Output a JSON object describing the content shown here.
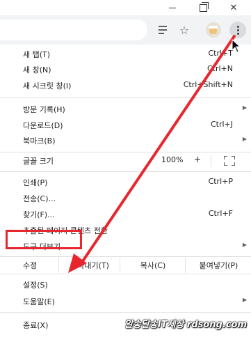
{
  "menu": {
    "new_tab": {
      "label": "새 탭(T)",
      "shortcut": "Ctrl+T"
    },
    "new_window": {
      "label": "새 창(N)",
      "shortcut": "Ctrl+N"
    },
    "incognito": {
      "label": "새 시크릿 창(I)",
      "shortcut": "Ctrl+Shift+N"
    },
    "history": {
      "label": "방문 기록(H)"
    },
    "downloads": {
      "label": "다운로드(D)",
      "shortcut": "Ctrl+J"
    },
    "bookmarks": {
      "label": "북마크(B)"
    },
    "zoom": {
      "label": "글꼴 크기",
      "value": "100%",
      "plus": "+"
    },
    "print": {
      "label": "인쇄(P)",
      "shortcut": "Ctrl+P"
    },
    "cast": {
      "label": "전송(C)..."
    },
    "find": {
      "label": "찾기(F)...",
      "shortcut": "Ctrl+F"
    },
    "distill": {
      "label": "추출된 페이지 콘텐츠 전환"
    },
    "more_tools": {
      "label": "도구 더보기"
    },
    "edit": {
      "label": "수정",
      "cut": "잘라내기(T)",
      "copy": "복사(C)",
      "paste": "붙여넣기(P)"
    },
    "settings": {
      "label": "설정(S)"
    },
    "help": {
      "label": "도움말(E)"
    },
    "exit": {
      "label": "종료(X)"
    }
  },
  "window": {
    "close_glyph": "✕",
    "star_glyph": "☆"
  },
  "watermark": "알송달송IT세상 rdsong.com",
  "colors": {
    "annotation_red": "#e8262e"
  }
}
